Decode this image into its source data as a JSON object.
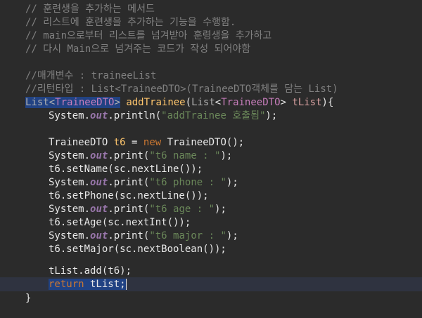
{
  "comments_top": [
    "// 훈련생을 추가하는 메서드",
    "// 리스트에 훈련생을 추가하는 기능을 수행함.",
    "// main으로부터 리스트를 넘겨받아 훈령생을 추가하고",
    "// 다시 Main으로 넘겨주는 코드가 작성 되어야함"
  ],
  "param_comment": "//매개변수 : traineeList",
  "return_comment": "//리턴타입 : List<TraineeDTO>(TraineeDTO객체를 담는 List)",
  "signature": {
    "ret_list": "List",
    "ret_lt": "<",
    "ret_generic": "TraineeDTO",
    "ret_gt": ">",
    "method": "addTrainee",
    "open": "(",
    "param_type": "List",
    "param_lt": "<",
    "param_generic": "TraineeDTO",
    "param_gt": ">",
    "param_name": "tList",
    "close": "){"
  },
  "println": {
    "prefix": "System.",
    "field": "out",
    "call": ".println(",
    "arg": "\"addTrainee 호출됨\"",
    "end": ");"
  },
  "new_line": {
    "type": "TraineeDTO",
    "var": "t6",
    "eq": " = ",
    "kw": "new",
    "ctor": " TraineeDTO();"
  },
  "prints": [
    {
      "prefix": "System.",
      "field": "out",
      "call": ".print(",
      "arg": "\"t6 name : \"",
      "end": ");"
    },
    {
      "prefix": "System.",
      "field": "out",
      "call": ".print(",
      "arg": "\"t6 phone : \"",
      "end": ");"
    },
    {
      "prefix": "System.",
      "field": "out",
      "call": ".print(",
      "arg": "\"t6 age : \"",
      "end": ");"
    },
    {
      "prefix": "System.",
      "field": "out",
      "call": ".print(",
      "arg": "\"t6 major : \"",
      "end": ");"
    }
  ],
  "setters": [
    "t6.setName(sc.nextLine());",
    "t6.setPhone(sc.nextLine());",
    "t6.setAge(sc.nextInt());",
    "t6.setMajor(sc.nextBoolean());"
  ],
  "add_line": "tList.add(t6);",
  "return_line": {
    "kw": "return",
    "rest": " tList;"
  },
  "closing_brace": "}"
}
